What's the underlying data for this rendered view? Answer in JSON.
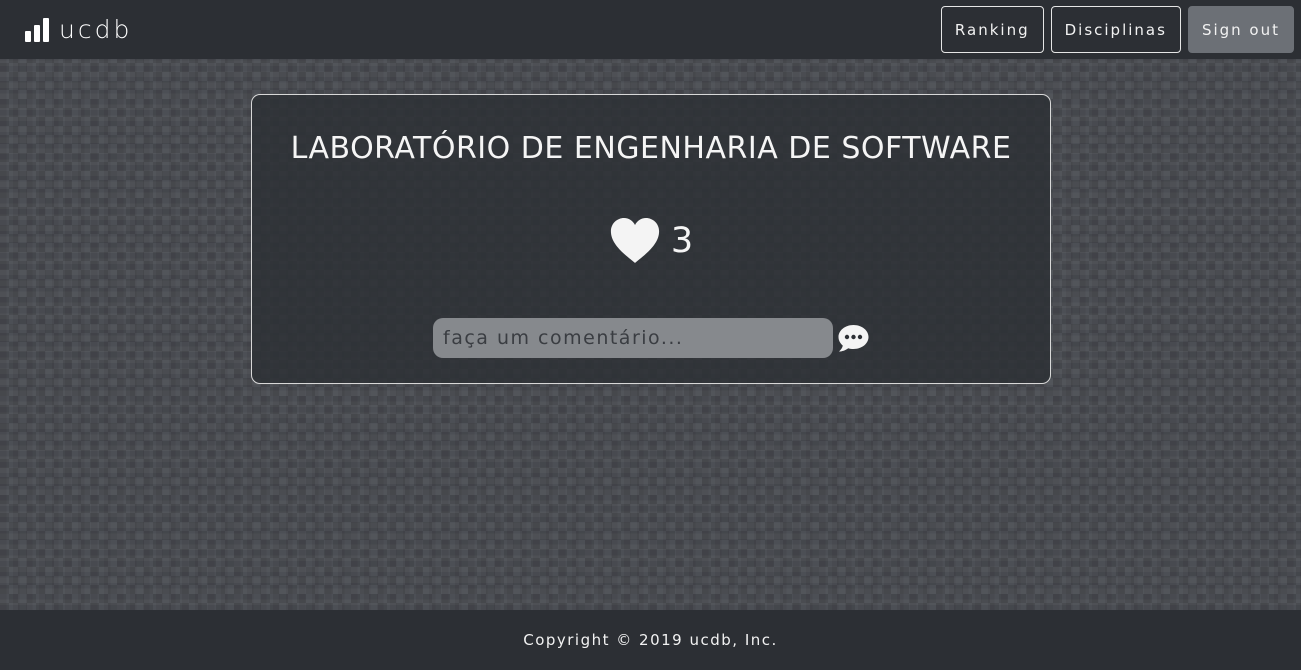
{
  "navbar": {
    "brand": "ucdb",
    "brand_icon": "bar-chart-icon",
    "buttons": {
      "ranking": "Ranking",
      "disciplinas": "Disciplinas",
      "signout": "Sign out"
    }
  },
  "card": {
    "title": "LABORATÓRIO DE ENGENHARIA DE SOFTWARE",
    "likes": "3",
    "like_icon": "heart-icon",
    "comment": {
      "placeholder": "faça um comentário...",
      "value": "",
      "send_icon": "speech-bubble-icon"
    }
  },
  "footer": {
    "copyright": "Copyright © 2019 ucdb, Inc."
  },
  "colors": {
    "navbar_bg": "#2c2f34",
    "card_bg": "#2c2f34",
    "signout_bg": "#6c7076",
    "input_bg": "#86898d",
    "text": "#f2f2f2"
  }
}
